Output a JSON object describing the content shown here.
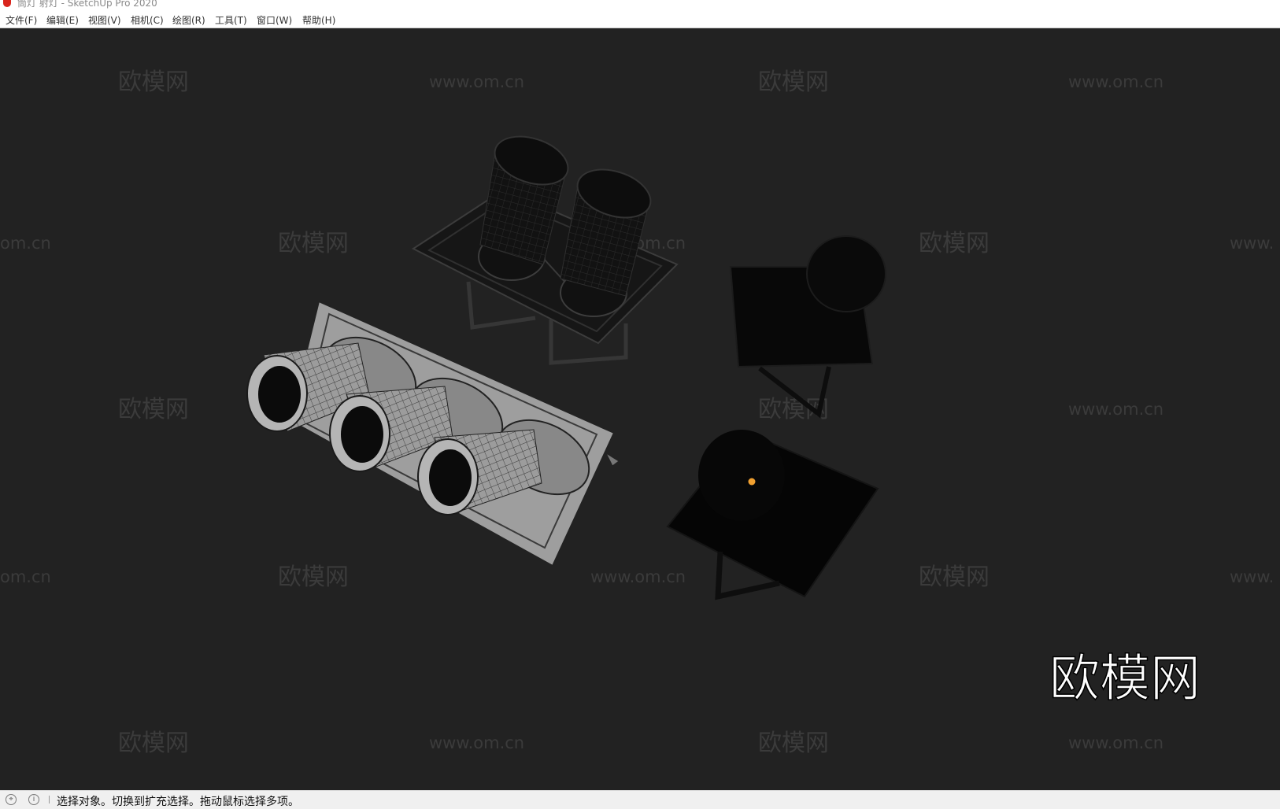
{
  "window": {
    "title": "筒灯 射灯 - SketchUp Pro 2020",
    "app_icon": "sketchup-logo-icon"
  },
  "menu": [
    {
      "label": "文件(F)"
    },
    {
      "label": "编辑(E)"
    },
    {
      "label": "视图(V)"
    },
    {
      "label": "相机(C)"
    },
    {
      "label": "绘图(R)"
    },
    {
      "label": "工具(T)"
    },
    {
      "label": "窗口(W)"
    },
    {
      "label": "帮助(H)"
    }
  ],
  "viewport": {
    "background": "#222222",
    "watermark": {
      "brand": "欧模网",
      "url": "www.om.cn",
      "url_partial_left": "om.cn",
      "url_partial_right": "www."
    },
    "logo_text": "欧模网",
    "cursor_color": "#f0a030"
  },
  "status": {
    "icons": [
      "geo-location-icon",
      "info-icon"
    ],
    "text": "选择对象。切换到扩充选择。拖动鼠标选择多项。"
  }
}
